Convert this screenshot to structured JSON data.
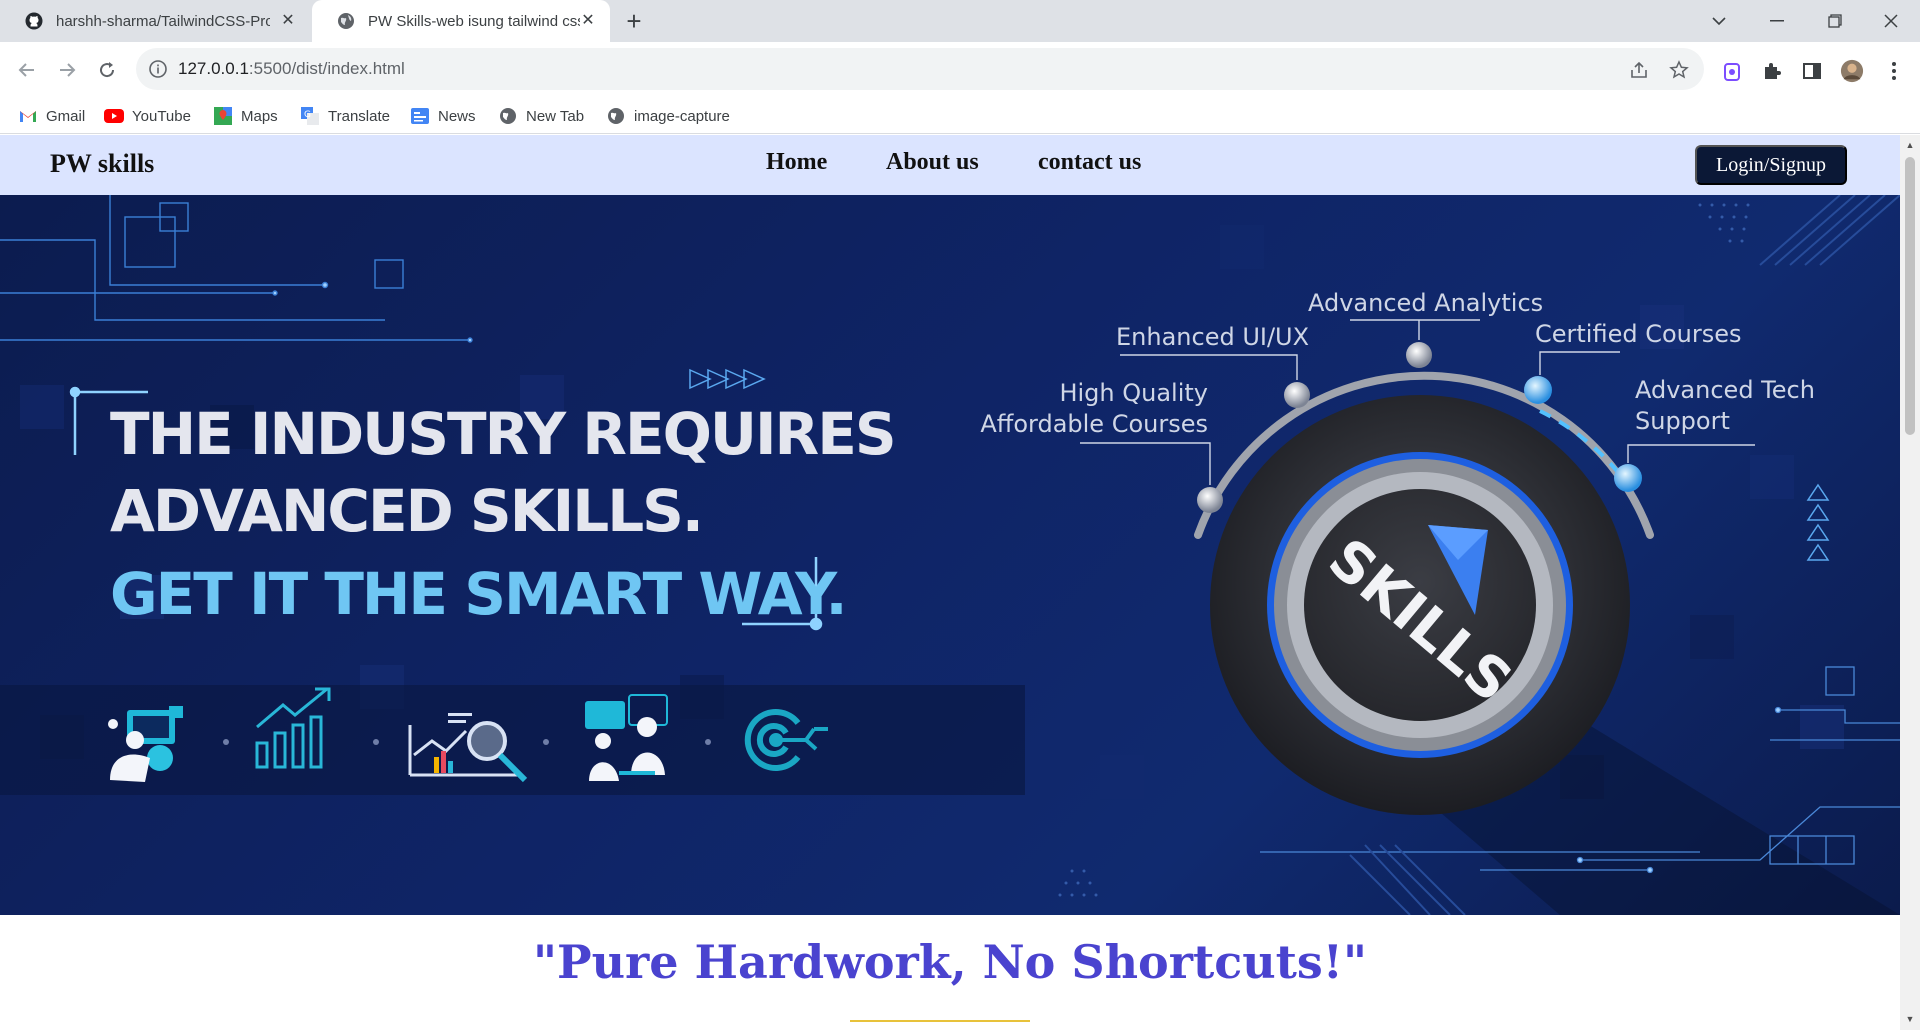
{
  "browser": {
    "tabs": [
      {
        "title": "harshh-sharma/TailwindCSS-Proj",
        "icon": "github-icon",
        "active": false
      },
      {
        "title": "PW Skills-web isung tailwind css",
        "icon": "globe-icon",
        "active": true
      }
    ],
    "url_host": "127.0.0.1",
    "url_rest": ":5500/dist/index.html",
    "bookmarks": [
      {
        "label": "Gmail",
        "icon": "gmail-icon"
      },
      {
        "label": "YouTube",
        "icon": "youtube-icon"
      },
      {
        "label": "Maps",
        "icon": "maps-icon"
      },
      {
        "label": "Translate",
        "icon": "translate-icon"
      },
      {
        "label": "News",
        "icon": "news-icon"
      },
      {
        "label": "New Tab",
        "icon": "globe-icon"
      },
      {
        "label": "image-capture",
        "icon": "globe-icon"
      }
    ]
  },
  "site": {
    "brand": "PW skills",
    "nav": [
      "Home",
      "About us",
      "contact us"
    ],
    "login": "Login/Signup"
  },
  "hero": {
    "line1": "THE INDUSTRY REQUIRES",
    "line2": "ADVANCED SKILLS.",
    "line3": "GET IT THE SMART WAY.",
    "dial_label": "SKILLS",
    "features": {
      "high_quality_1": "High Quality",
      "high_quality_2": "Affordable Courses",
      "enhanced": "Enhanced UI/UX",
      "analytics": "Advanced Analytics",
      "certified": "Certified Courses",
      "tech_1": "Advanced Tech",
      "tech_2": "Support"
    },
    "accent_color": "#6fc6f3",
    "background_color": "#0f2466"
  },
  "tagline": "\"Pure Hardwork, No Shortcuts!\"",
  "colors": {
    "nav_bg": "#dbe4ff",
    "login_bg": "#0b1836",
    "tagline": "#4a43cf"
  }
}
